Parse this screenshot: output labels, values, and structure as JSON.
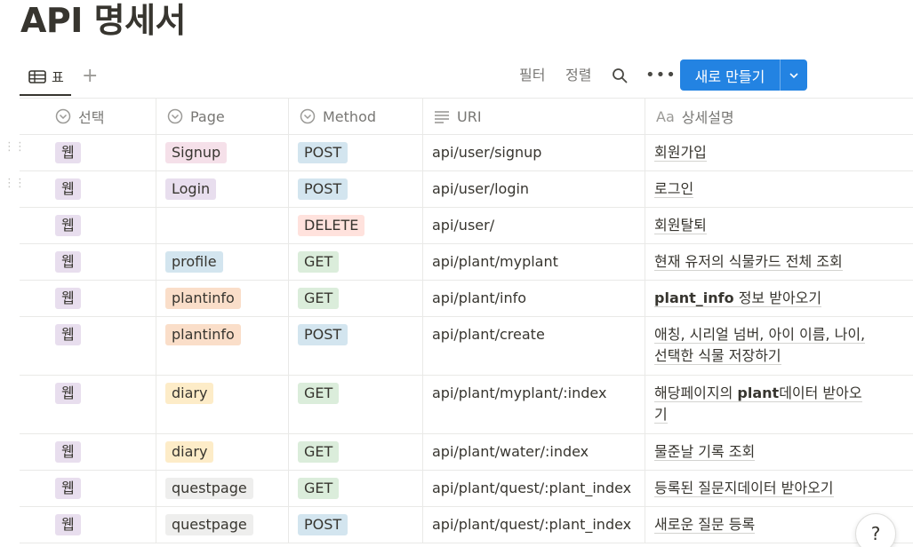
{
  "page": {
    "title": "API 명세서"
  },
  "view": {
    "tab_label": "표",
    "add_view_icon": "plus-icon",
    "filter_label": "필터",
    "sort_label": "정렬",
    "search_icon": "search-icon",
    "more_label": "•••",
    "new_button_label": "새로 만들기"
  },
  "columns": [
    {
      "label": "선택",
      "icon": "select-icon"
    },
    {
      "label": "Page",
      "icon": "select-icon"
    },
    {
      "label": "Method",
      "icon": "select-icon"
    },
    {
      "label": "URI",
      "icon": "text-icon"
    },
    {
      "label": "상세설명",
      "icon": "title-icon",
      "prefix": "Aa"
    }
  ],
  "rows": [
    {
      "select": "웹",
      "page": "Signup",
      "page_color": "#f5e0e9",
      "method": "POST",
      "method_color": "#d3e5ef",
      "uri": "api/user/signup",
      "desc": [
        "회원가입"
      ]
    },
    {
      "select": "웹",
      "page": "Login",
      "page_color": "#e8deee",
      "method": "POST",
      "method_color": "#d3e5ef",
      "uri": "api/user/login",
      "desc": [
        "로그인"
      ]
    },
    {
      "select": "웹",
      "page": "",
      "page_color": "",
      "method": "DELETE",
      "method_color": "#ffe2dd",
      "uri": "api/user/",
      "desc": [
        "회원탈퇴"
      ]
    },
    {
      "select": "웹",
      "page": "profile",
      "page_color": "#d3e5ef",
      "method": "GET",
      "method_color": "#dbeddb",
      "uri": "api/plant/myplant",
      "desc": [
        "현재 유저의 식물카드 전체 조회"
      ]
    },
    {
      "select": "웹",
      "page": "plantinfo",
      "page_color": "#fadec9",
      "method": "GET",
      "method_color": "#dbeddb",
      "uri": "api/plant/info",
      "desc_bold": "plant_info",
      "desc": [
        " 정보 받아오기"
      ]
    },
    {
      "select": "웹",
      "page": "plantinfo",
      "page_color": "#fadec9",
      "method": "POST",
      "method_color": "#d3e5ef",
      "uri": "api/plant/create",
      "desc": [
        "애칭, 시리얼 넘버, 아이 이름, 나이,",
        "선택한 식물 저장하기"
      ]
    },
    {
      "select": "웹",
      "page": "diary",
      "page_color": "#fdecc8",
      "method": "GET",
      "method_color": "#dbeddb",
      "uri": "api/plant/myplant/:index",
      "desc_pre": "해당페이지의 ",
      "desc_bold": "plant",
      "desc": [
        "데이터 받아오",
        "기"
      ]
    },
    {
      "select": "웹",
      "page": "diary",
      "page_color": "#fdecc8",
      "method": "GET",
      "method_color": "#dbeddb",
      "uri": "api/plant/water/:index",
      "desc": [
        "물준날 기록 조회"
      ]
    },
    {
      "select": "웹",
      "page": "questpage",
      "page_color": "#eeeeed",
      "method": "GET",
      "method_color": "#dbeddb",
      "uri": "api/plant/quest/:plant_index",
      "desc": [
        "등록된 질문지데이터 받아오기"
      ]
    },
    {
      "select": "웹",
      "page": "questpage",
      "page_color": "#eeeeed",
      "method": "POST",
      "method_color": "#d3e5ef",
      "uri": "api/plant/quest/:plant_index",
      "desc": [
        "새로운 질문 등록"
      ]
    }
  ],
  "select_color": "#e8deee",
  "help_label": "?"
}
